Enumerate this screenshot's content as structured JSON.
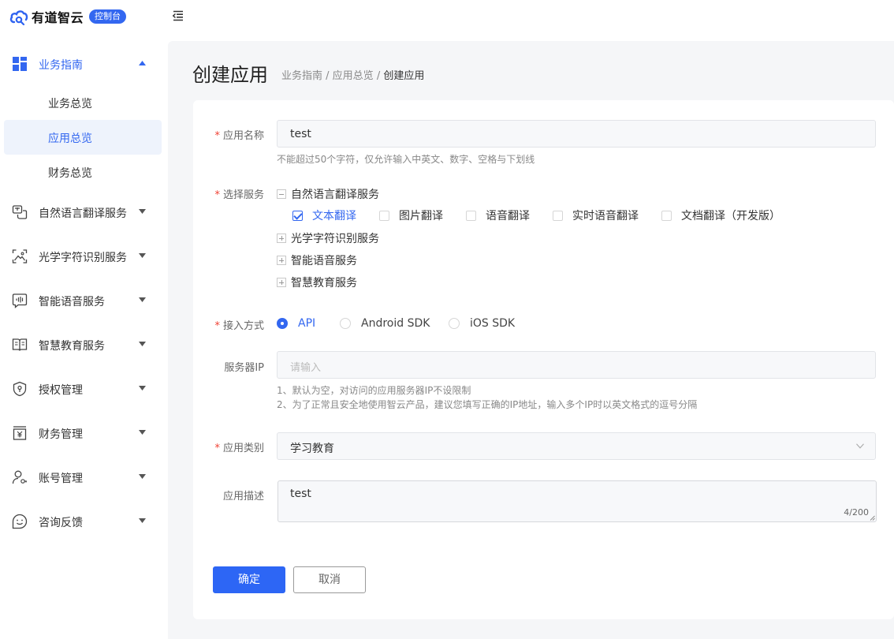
{
  "header": {
    "logo_text": "有道智云",
    "console_badge": "控制台"
  },
  "sidebar": {
    "groups": [
      {
        "label": "业务指南",
        "icon": "grid-icon",
        "expanded": true,
        "children": [
          {
            "label": "业务总览"
          },
          {
            "label": "应用总览",
            "active": true
          },
          {
            "label": "财务总览"
          }
        ]
      },
      {
        "label": "自然语言翻译服务",
        "icon": "translate-icon"
      },
      {
        "label": "光学字符识别服务",
        "icon": "image-scan-icon"
      },
      {
        "label": "智能语音服务",
        "icon": "voice-icon"
      },
      {
        "label": "智慧教育服务",
        "icon": "book-icon"
      },
      {
        "label": "授权管理",
        "icon": "shield-icon"
      },
      {
        "label": "财务管理",
        "icon": "yen-icon"
      },
      {
        "label": "账号管理",
        "icon": "user-key-icon"
      },
      {
        "label": "咨询反馈",
        "icon": "smile-chat-icon"
      }
    ]
  },
  "page": {
    "title": "创建应用",
    "breadcrumb": {
      "part1": "业务指南",
      "sep1": " / ",
      "part2": "应用总览",
      "sep2": " / ",
      "current": "创建应用"
    }
  },
  "form": {
    "required_mark": "*",
    "app_name": {
      "label": "应用名称",
      "value": "test",
      "hint": "不能超过50个字符，仅允许输入中英文、数字、空格与下划线"
    },
    "services": {
      "label": "选择服务",
      "groups": [
        {
          "label": "自然语言翻译服务",
          "expanded": true,
          "options": [
            {
              "label": "文本翻译",
              "checked": true
            },
            {
              "label": "图片翻译",
              "checked": false
            },
            {
              "label": "语音翻译",
              "checked": false
            },
            {
              "label": "实时语音翻译",
              "checked": false
            },
            {
              "label": "文档翻译（开发版）",
              "checked": false
            }
          ]
        },
        {
          "label": "光学字符识别服务",
          "expanded": false
        },
        {
          "label": "智能语音服务",
          "expanded": false
        },
        {
          "label": "智慧教育服务",
          "expanded": false
        }
      ]
    },
    "access": {
      "label": "接入方式",
      "options": [
        {
          "label": "API",
          "checked": true
        },
        {
          "label": "Android SDK",
          "checked": false
        },
        {
          "label": "iOS SDK",
          "checked": false
        }
      ]
    },
    "server_ip": {
      "label": "服务器IP",
      "placeholder": "请输入",
      "hints": [
        "1、默认为空，对访问的应用服务器IP不设限制",
        "2、为了正常且安全地使用智云产品，建议您填写正确的IP地址，输入多个IP时以英文格式的逗号分隔"
      ]
    },
    "category": {
      "label": "应用类别",
      "value": "学习教育"
    },
    "description": {
      "label": "应用描述",
      "value": "test",
      "counter": "4/200"
    },
    "confirm_label": "确定",
    "cancel_label": "取消"
  },
  "colors": {
    "accent": "#3367f0",
    "required": "#f04134",
    "page_bg": "#f5f6f8"
  }
}
